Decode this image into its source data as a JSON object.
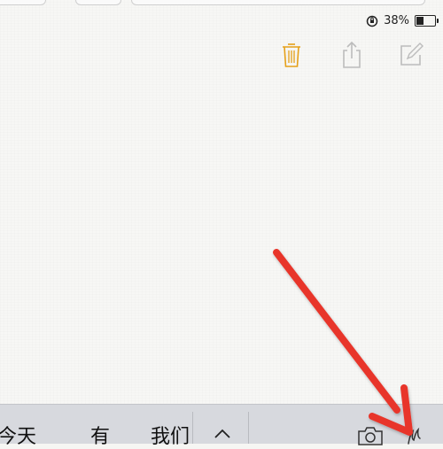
{
  "status_bar": {
    "battery_percent_label": "38%",
    "battery_level": 0.38,
    "orientation_lock_icon": "orientation-lock-icon"
  },
  "toolbar": {
    "trash_icon": "trash-icon",
    "share_icon": "share-icon",
    "compose_icon": "compose-icon",
    "trash_color": "#e5a019"
  },
  "keyboard": {
    "suggestions": [
      "今天",
      "有",
      "我们"
    ],
    "collapse_icon": "chevron-up-icon",
    "camera_icon": "camera-icon",
    "sketch_icon": "sketch-icon"
  },
  "annotation": {
    "arrow_color": "#e8342a"
  }
}
